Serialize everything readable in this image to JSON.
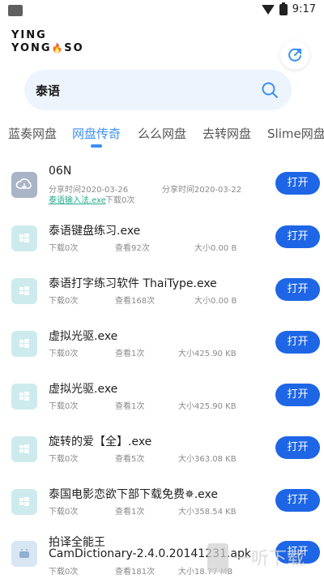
{
  "status_bar": {
    "time": "9:17"
  },
  "header": {
    "logo_line1": "YING",
    "logo_line2a": "YONG",
    "logo_line2b": "SO"
  },
  "search": {
    "query": "泰语"
  },
  "tabs": [
    {
      "label": "蓝奏网盘"
    },
    {
      "label": "网盘传奇"
    },
    {
      "label": "么么网盘"
    },
    {
      "label": "去转网盘"
    },
    {
      "label": "Slime网盘"
    }
  ],
  "active_tab": "网盘传奇",
  "items": [
    {
      "title": "06N",
      "share_label": "分享时间2020-03-26",
      "share_label2": "分享时间2020-03-22",
      "link": "泰语输入法.exe",
      "downloads": "下载0次",
      "button": "打开"
    },
    {
      "title": "泰语键盘练习.exe",
      "downloads": "下载0次",
      "views": "查看92次",
      "size": "大小0.00 B",
      "button": "打开"
    },
    {
      "title": "泰语打字练习软件 ThaiType.exe",
      "downloads": "下载0次",
      "views": "查看168次",
      "size": "大小0.00 B",
      "button": "打开"
    },
    {
      "title": "虚拟光驱.exe",
      "downloads": "下载0次",
      "views": "查看1次",
      "size": "大小425.90 KB",
      "button": "打开"
    },
    {
      "title": "虚拟光驱.exe",
      "downloads": "下载0次",
      "views": "查看1次",
      "size": "大小425.90 KB",
      "button": "打开"
    },
    {
      "title": "旋转的爱【全】.exe",
      "downloads": "下载0次",
      "views": "查看5次",
      "size": "大小363.08 KB",
      "button": "打开"
    },
    {
      "title": "泰国电影恋欲下部下载免费✵.exe",
      "downloads": "下载0次",
      "views": "查看1次",
      "size": "大小358.54 KB",
      "button": "打开"
    },
    {
      "title": "拍译全能王",
      "title2": "CamDictionary-2.4.0.20141231.apk",
      "downloads": "下载0次",
      "views": "查看181次",
      "size": "大小18.77 MB",
      "button": "打开"
    }
  ],
  "watermark": {
    "text": "一听下载"
  },
  "colors": {
    "accent": "#3b8ff3",
    "button": "#1e66e6",
    "search_bg": "#eef4fd",
    "link": "#26a98d"
  }
}
